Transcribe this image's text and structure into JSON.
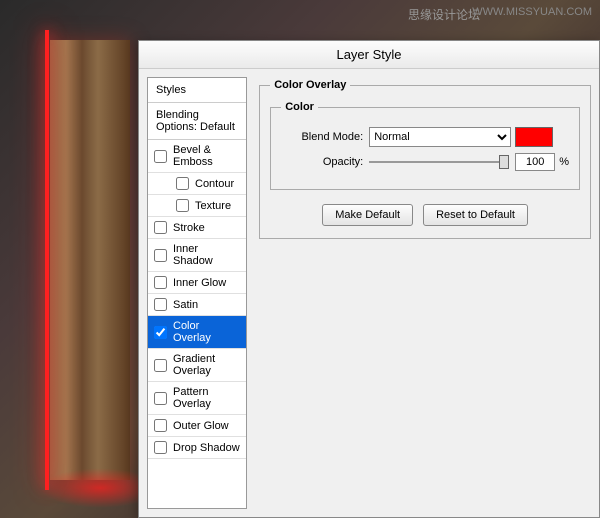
{
  "watermark": {
    "text": "思缘设计论坛",
    "url": "WWW.MISSYUAN.COM"
  },
  "dialog": {
    "title": "Layer Style"
  },
  "sidebar": {
    "header": "Styles",
    "blending": "Blending Options: Default",
    "items": [
      {
        "label": "Bevel & Emboss",
        "checked": false,
        "indent": false
      },
      {
        "label": "Contour",
        "checked": false,
        "indent": true
      },
      {
        "label": "Texture",
        "checked": false,
        "indent": true
      },
      {
        "label": "Stroke",
        "checked": false,
        "indent": false
      },
      {
        "label": "Inner Shadow",
        "checked": false,
        "indent": false
      },
      {
        "label": "Inner Glow",
        "checked": false,
        "indent": false
      },
      {
        "label": "Satin",
        "checked": false,
        "indent": false
      },
      {
        "label": "Color Overlay",
        "checked": true,
        "indent": false,
        "selected": true
      },
      {
        "label": "Gradient Overlay",
        "checked": false,
        "indent": false
      },
      {
        "label": "Pattern Overlay",
        "checked": false,
        "indent": false
      },
      {
        "label": "Outer Glow",
        "checked": false,
        "indent": false
      },
      {
        "label": "Drop Shadow",
        "checked": false,
        "indent": false
      }
    ]
  },
  "panel": {
    "group_title": "Color Overlay",
    "inner_title": "Color",
    "blend_mode_label": "Blend Mode:",
    "blend_mode_value": "Normal",
    "opacity_label": "Opacity:",
    "opacity_value": "100",
    "opacity_unit": "%",
    "color_swatch": "#ff0000",
    "make_default": "Make Default",
    "reset_default": "Reset to Default"
  }
}
